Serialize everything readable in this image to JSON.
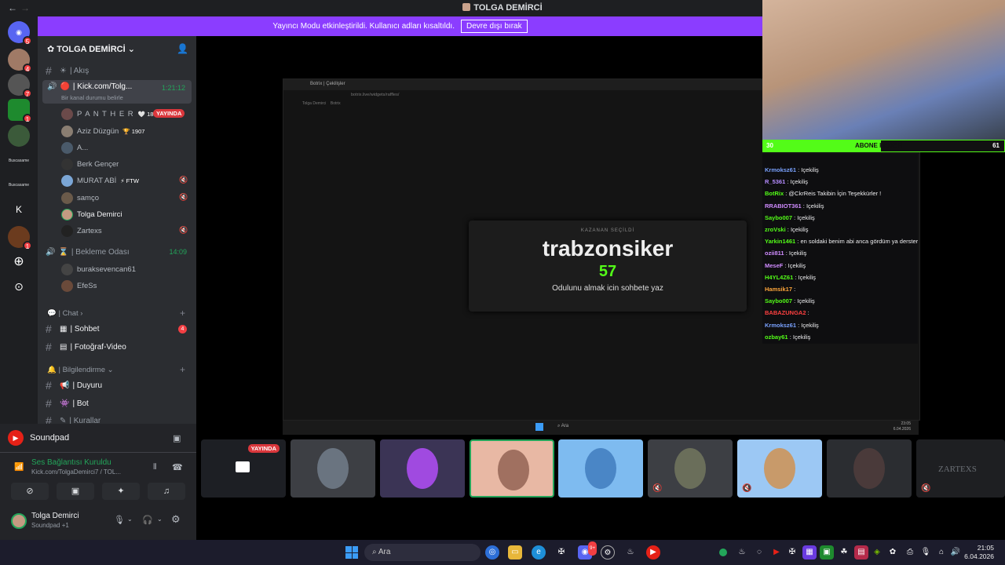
{
  "window": {
    "title": "TOLGA DEMİRCİ",
    "back": "←",
    "forward": "→"
  },
  "banner": {
    "message": "Yayıncı Modu etkinleştirildi. Kullanıcı adları kısaltıldı.",
    "button": "Devre dışı bırak"
  },
  "rail": {
    "badges": [
      "5",
      "4",
      "7",
      "1",
      "1"
    ],
    "labels": [
      "K"
    ],
    "text_servers": [
      "Buscasame",
      "Buscasame"
    ]
  },
  "sidebar": {
    "server_name": "TOLGA DEMİRCİ",
    "channels": {
      "akis": "| Akış",
      "kick_voice": "| Kick.com/Tolg...",
      "kick_voice_timer": "1:21:12",
      "kick_voice_status": "Bir kanal durumu belirle",
      "bekleme": "| Bekleme Odası",
      "bekleme_timer": "14:09",
      "chat_category": "| Chat",
      "sohbet": "| Sohbet",
      "sohbet_unread": "4",
      "fotograf": "| Fotoğraf-Video",
      "bilgi_category": "| Bilgilendirme",
      "duyuru": "| Duyuru",
      "bot": "| Bot",
      "kurallar": "| Kurallar"
    },
    "voice_users": [
      {
        "name": "P A N T H E R",
        "extra": "🤍 1881",
        "live": "YAYINDA"
      },
      {
        "name": "Aziz Düzgün",
        "extra": "🏆 1907",
        "live": ""
      },
      {
        "name": "A...",
        "extra": "",
        "live": ""
      },
      {
        "name": "Berk Gençer",
        "extra": "",
        "live": ""
      },
      {
        "name": "MURAT ABİ",
        "extra": "⚡ FTW",
        "live": ""
      },
      {
        "name": "samço",
        "extra": "",
        "live": ""
      },
      {
        "name": "Tolga Demirci",
        "extra": "",
        "live": ""
      },
      {
        "name": "Zartexs",
        "extra": "",
        "live": ""
      }
    ],
    "waiting_users": [
      {
        "name": "buraksevencan61"
      },
      {
        "name": "EfeSs"
      }
    ]
  },
  "bottom": {
    "app_name": "Soundpad",
    "voice_status": "Ses Bağlantısı Kuruldu",
    "voice_channel": "Kick.com/TolgaDemirci7 / TOL...",
    "user_name": "Tolga Demirci",
    "user_status": "Soundpad +1"
  },
  "stream": {
    "browser_tab": "Botrix | Çekilişler",
    "browser_url": "botrix.live/widgets/raffles/",
    "bookmark1": "Tolga Demirci",
    "bookmark2": "Botrix",
    "winner_label": "KAZANAN SEÇİLDİ",
    "winner_name": "trabzonsiker",
    "winner_number": "57",
    "winner_note": "Odulunu almak icin sohbete yaz",
    "inner_search": "Ara",
    "inner_time": "23:05",
    "inner_date": "6.04.2026"
  },
  "webcam": {
    "goal_left": "30",
    "goal_label": "ABONE HEDEFİ",
    "goal_right": "61",
    "goal_progress": 0.49
  },
  "chat": [
    {
      "user": "Krmoksz61",
      "text": ": Içekiliş",
      "color": "#7aa2ff"
    },
    {
      "user": "R_5361",
      "text": ": Içekiliş",
      "color": "#b58cff"
    },
    {
      "user": "BotRix",
      "text": ": @CkrReis Takibin İçin Teşekkürler !",
      "color": "#53fc18"
    },
    {
      "user": "RRABIOT361",
      "text": ": Içekiliş",
      "color": "#d08cff"
    },
    {
      "user": "Saybo007",
      "text": ": Içekiliş",
      "color": "#53fc18"
    },
    {
      "user": "zroVski",
      "text": ": Içekiliş",
      "color": "#53fc18"
    },
    {
      "user": "Yarkin1461",
      "text": ": en soldaki benim abi anca gördüm ya dersterydim",
      "color": "#53fc18"
    },
    {
      "user": "ozii811",
      "text": ": Içekiliş",
      "color": "#d08cff"
    },
    {
      "user": "MeseF",
      "text": ": Içekiliş",
      "color": "#d08cff"
    },
    {
      "user": "H4YL4Z61",
      "text": ": Içekiliş",
      "color": "#53fc18"
    },
    {
      "user": "Hamsik17",
      "text": ":",
      "color": "#ffa63b"
    },
    {
      "user": "Saybo007",
      "text": ": Içekiliş",
      "color": "#53fc18"
    },
    {
      "user": "BABAZUNGA2",
      "text": ":",
      "color": "#ff4040"
    },
    {
      "user": "Krmoksz61",
      "text": ": Içekiliş",
      "color": "#7aa2ff"
    },
    {
      "user": "ozbay61",
      "text": ": Içekiliş",
      "color": "#53fc18"
    }
  ],
  "tiles": {
    "live_label": "YAYINDA",
    "zartexs_label": "ZARTEXS"
  },
  "taskbar": {
    "search": "Ara",
    "time": "21:05",
    "date": "6.04.2026",
    "discord_badge": "9+"
  }
}
